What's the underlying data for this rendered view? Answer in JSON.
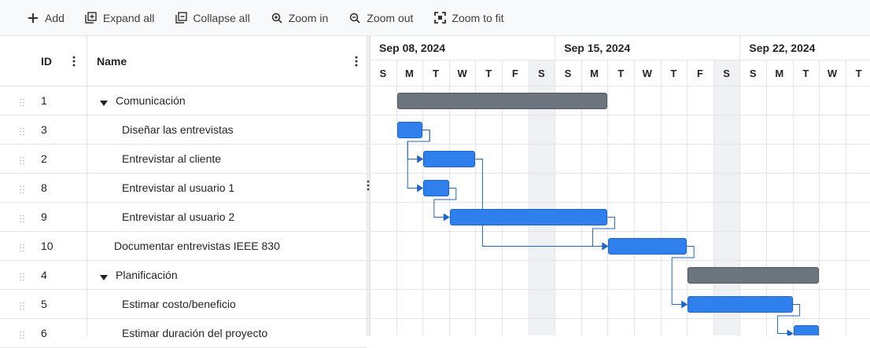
{
  "toolbar": {
    "add": "Add",
    "expand_all": "Expand all",
    "collapse_all": "Collapse all",
    "zoom_in": "Zoom in",
    "zoom_out": "Zoom out",
    "zoom_to_fit": "Zoom to fit"
  },
  "grid": {
    "id_header": "ID",
    "name_header": "Name",
    "rows": [
      {
        "id": "1",
        "name": "Comunicación",
        "summary": true
      },
      {
        "id": "3",
        "name": "Diseñar las entrevistas",
        "summary": false
      },
      {
        "id": "2",
        "name": "Entrevistar al cliente",
        "summary": false
      },
      {
        "id": "8",
        "name": "Entrevistar al usuario 1",
        "summary": false
      },
      {
        "id": "9",
        "name": "Entrevistar al usuario 2",
        "summary": false
      },
      {
        "id": "10",
        "name": "Documentar entrevistas IEEE 830",
        "summary": false
      },
      {
        "id": "4",
        "name": "Planificación",
        "summary": true
      },
      {
        "id": "5",
        "name": "Estimar costo/beneficio",
        "summary": false
      },
      {
        "id": "6",
        "name": "Estimar duración del proyecto",
        "summary": false
      }
    ]
  },
  "timeline": {
    "weeks": [
      "Sep 08, 2024",
      "Sep 15, 2024",
      "Sep 22, 2024"
    ],
    "days": [
      "S",
      "M",
      "T",
      "W",
      "T",
      "F",
      "S",
      "S",
      "M",
      "T",
      "W",
      "T",
      "F",
      "S",
      "S",
      "M",
      "T",
      "W",
      "T"
    ]
  },
  "colors": {
    "task_bar": "#2f80ed",
    "summary_bar": "#6c757d",
    "dependency_line": "#1f65c9",
    "weekend_shade": "#f0f1f5"
  },
  "icons": {
    "add": "plus-icon",
    "expand_all": "expand-all-icon",
    "collapse_all": "collapse-all-icon",
    "zoom_in": "zoom-in-icon",
    "zoom_out": "zoom-out-icon",
    "zoom_to_fit": "zoom-to-fit-icon"
  }
}
